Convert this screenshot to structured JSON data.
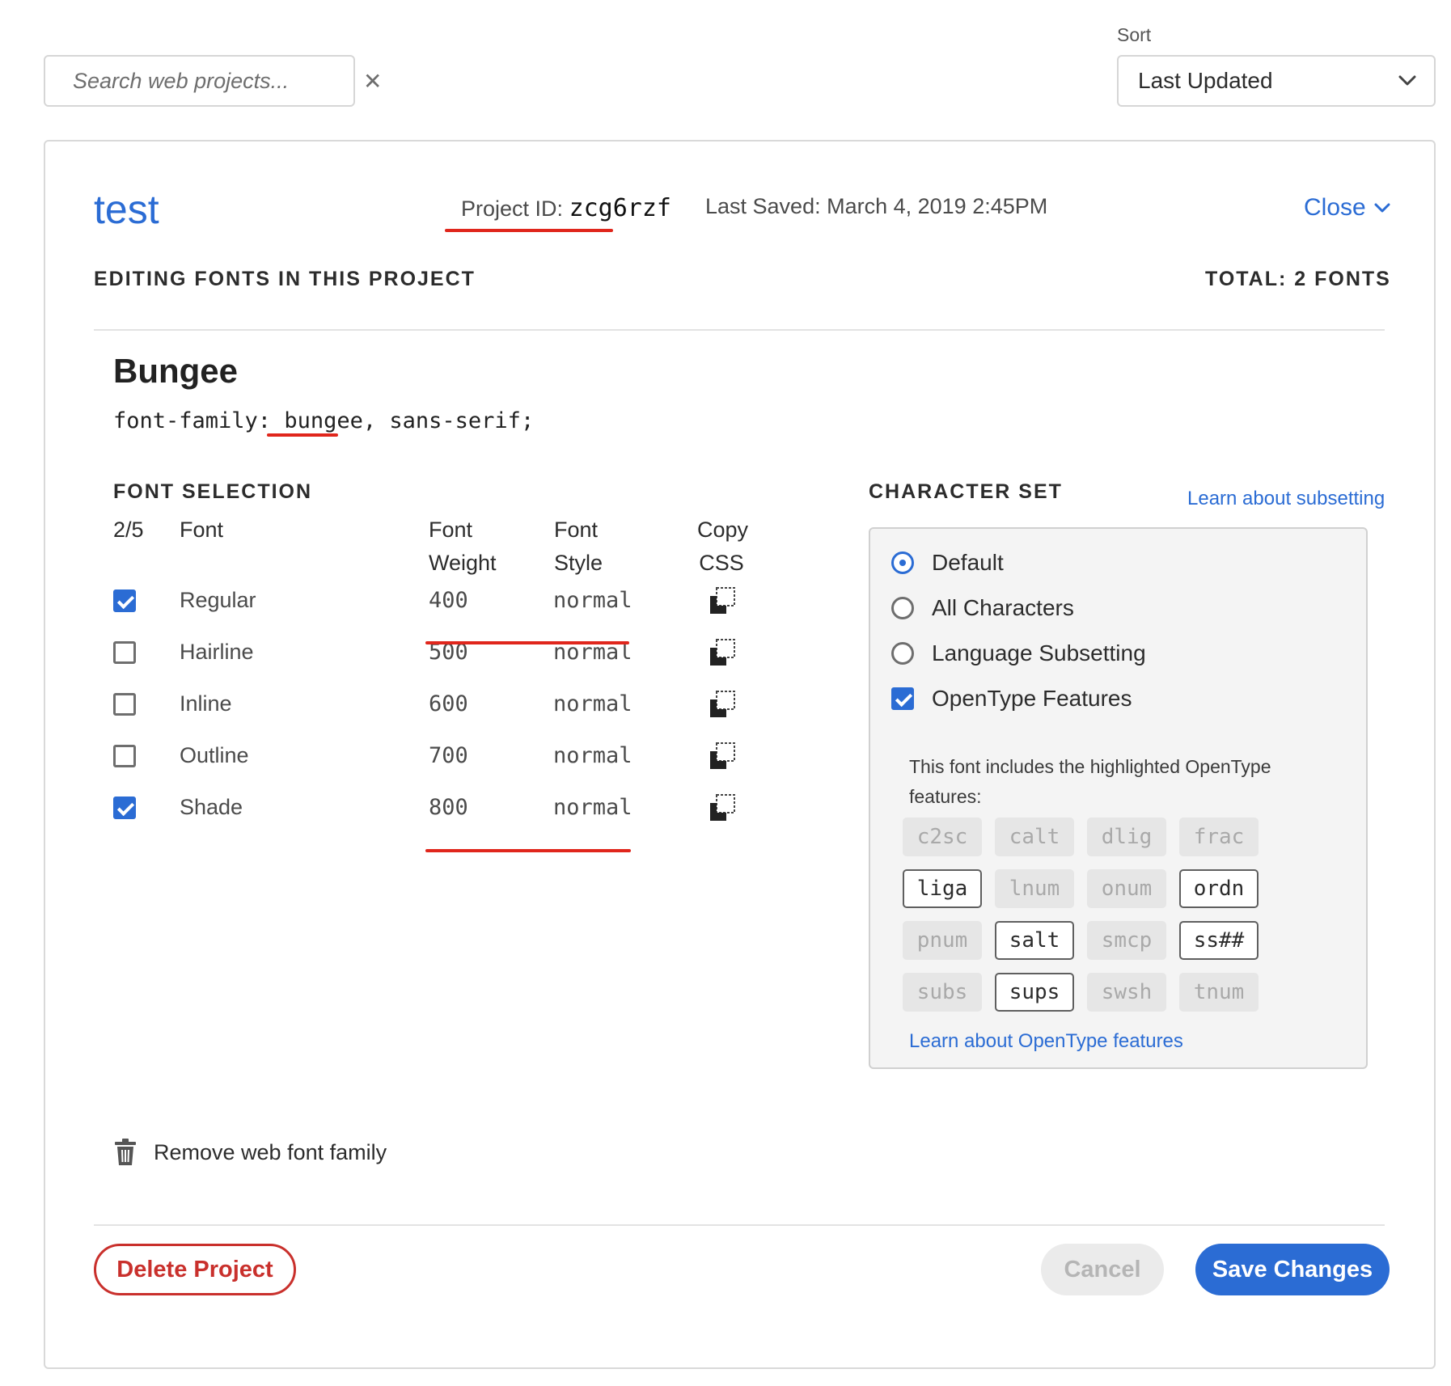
{
  "search": {
    "placeholder": "Search web projects...",
    "clear_icon": "close-icon"
  },
  "sort": {
    "label": "Sort",
    "selected": "Last Updated"
  },
  "project": {
    "name": "test",
    "id_label": "Project ID:",
    "id_value": "zcg6rzf",
    "last_saved": "Last Saved: March 4, 2019 2:45PM",
    "close_label": "Close"
  },
  "editing": {
    "heading": "EDITING FONTS IN THIS PROJECT",
    "total": "TOTAL: 2 FONTS"
  },
  "family": {
    "name": "Bungee",
    "css_prefix": "font-family: ",
    "css_slug": "bungee",
    "css_suffix": ", sans-serif;"
  },
  "font_selection": {
    "heading": "FONT SELECTION",
    "headers": {
      "count": "2/5",
      "font": "Font",
      "weight": "Font\nWeight",
      "style": "Font\nStyle",
      "copy": "Copy\nCSS"
    },
    "rows": [
      {
        "name": "Regular",
        "weight": "400",
        "style": "normal",
        "checked": true
      },
      {
        "name": "Hairline",
        "weight": "500",
        "style": "normal",
        "checked": false
      },
      {
        "name": "Inline",
        "weight": "600",
        "style": "normal",
        "checked": false
      },
      {
        "name": "Outline",
        "weight": "700",
        "style": "normal",
        "checked": false
      },
      {
        "name": "Shade",
        "weight": "800",
        "style": "normal",
        "checked": true
      }
    ]
  },
  "character_set": {
    "heading": "CHARACTER SET",
    "learn_subsetting": "Learn about subsetting",
    "options": [
      {
        "label": "Default",
        "type": "radio",
        "selected": true
      },
      {
        "label": "All Characters",
        "type": "radio",
        "selected": false
      },
      {
        "label": "Language Subsetting",
        "type": "radio",
        "selected": false
      },
      {
        "label": "OpenType Features",
        "type": "checkbox",
        "selected": true
      }
    ],
    "opentype_description": "This font includes the highlighted OpenType features:",
    "features": [
      {
        "tag": "c2sc",
        "on": false
      },
      {
        "tag": "calt",
        "on": false
      },
      {
        "tag": "dlig",
        "on": false
      },
      {
        "tag": "frac",
        "on": false
      },
      {
        "tag": "liga",
        "on": true
      },
      {
        "tag": "lnum",
        "on": false
      },
      {
        "tag": "onum",
        "on": false
      },
      {
        "tag": "ordn",
        "on": true
      },
      {
        "tag": "pnum",
        "on": false
      },
      {
        "tag": "salt",
        "on": true
      },
      {
        "tag": "smcp",
        "on": false
      },
      {
        "tag": "ss##",
        "on": true
      },
      {
        "tag": "subs",
        "on": false
      },
      {
        "tag": "sups",
        "on": true
      },
      {
        "tag": "swsh",
        "on": false
      },
      {
        "tag": "tnum",
        "on": false
      }
    ],
    "learn_opentype": "Learn about OpenType features"
  },
  "remove_family": "Remove web font family",
  "actions": {
    "delete": "Delete Project",
    "cancel": "Cancel",
    "save": "Save Changes"
  },
  "colors": {
    "accent": "#2b6cd4",
    "danger": "#c9302c",
    "annotation": "#e0261c"
  }
}
